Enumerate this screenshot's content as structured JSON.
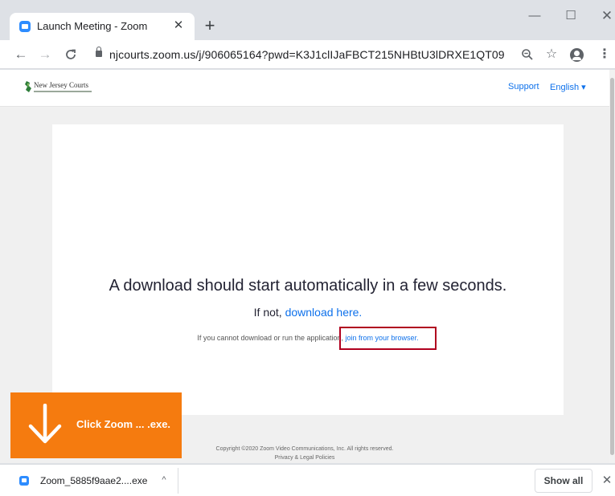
{
  "browser": {
    "tab": {
      "title": "Launch Meeting - Zoom",
      "close_glyph": "✕",
      "favicon": "zoom-icon"
    },
    "new_tab_glyph": "+",
    "window_controls": {
      "minimize": "—",
      "maximize": "☐",
      "close": "✕"
    },
    "nav": {
      "back": "←",
      "forward": "→",
      "reload": "C"
    },
    "url": "njcourts.zoom.us/j/906065164?pwd=K3J1clIJaFBCT215NHBtU3lDRXE1QT09",
    "toolbar_icons": {
      "zoom": "⊖",
      "bookmark": "☆",
      "menu": "⋮"
    }
  },
  "site": {
    "logo_text": "New Jersey Courts",
    "nav": {
      "support": "Support",
      "language": "English ▾"
    }
  },
  "main": {
    "headline": "A download should start automatically in a few seconds.",
    "subline_prefix": "If not, ",
    "subline_link": "download here.",
    "small_prefix": "If you cannot download or run the application, ",
    "small_link": "join from your browser."
  },
  "footer": {
    "copyright": "Copyright ©2020 Zoom Video Communications, Inc. All rights reserved.",
    "legal": "Privacy & Legal Policies"
  },
  "overlay": {
    "text": "Click Zoom ... .exe.",
    "color": "#f57b0f"
  },
  "download_shelf": {
    "file_name": "Zoom_5885f9aae2....exe",
    "caret": "^",
    "show_all": "Show all",
    "close": "✕"
  },
  "colors": {
    "link": "#0e71eb",
    "highlight": "#b0001f",
    "zoom_blue": "#2d8cff"
  }
}
